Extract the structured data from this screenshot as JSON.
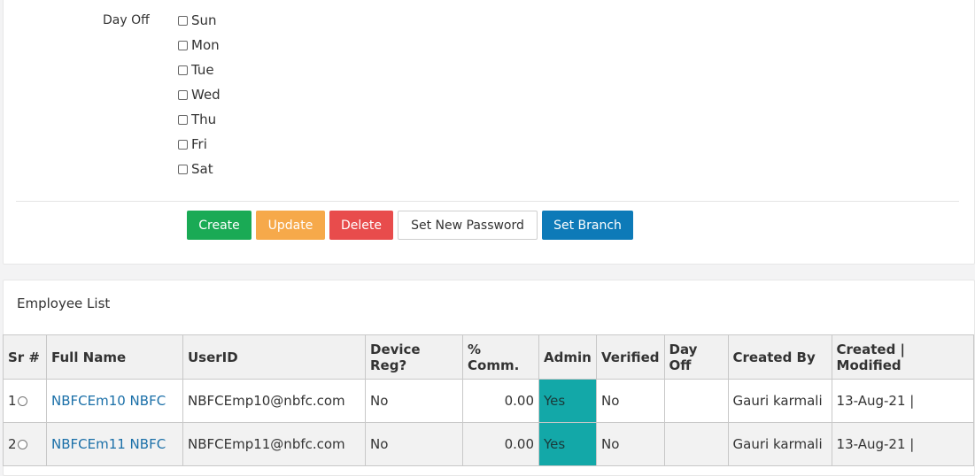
{
  "form": {
    "day_off_label": "Day Off",
    "days": [
      "Sun",
      "Mon",
      "Tue",
      "Wed",
      "Thu",
      "Fri",
      "Sat"
    ]
  },
  "buttons": {
    "create": "Create",
    "update": "Update",
    "delete": "Delete",
    "set_password": "Set New Password",
    "set_branch": "Set Branch"
  },
  "list": {
    "title": "Employee List",
    "headers": {
      "sr": "Sr #",
      "full_name": "Full Name",
      "userid": "UserID",
      "device_reg": "Device Reg?",
      "comm": "% Comm.",
      "admin": "Admin",
      "verified": "Verified",
      "day_off": "Day Off",
      "created_by": "Created By",
      "created_modified": "Created | Modified"
    },
    "rows": [
      {
        "sr": "1",
        "full_name": "NBFCEm10 NBFC",
        "userid": "NBFCEmp10@nbfc.com",
        "device_reg": "No",
        "comm": "0.00",
        "admin": "Yes",
        "verified": "No",
        "day_off": "",
        "created_by": "Gauri karmali",
        "created_modified": "13-Aug-21 |"
      },
      {
        "sr": "2",
        "full_name": "NBFCEm11 NBFC",
        "userid": "NBFCEmp11@nbfc.com",
        "device_reg": "No",
        "comm": "0.00",
        "admin": "Yes",
        "verified": "No",
        "day_off": "",
        "created_by": "Gauri karmali",
        "created_modified": "13-Aug-21 |"
      }
    ]
  },
  "colors": {
    "create": "#1aaa55",
    "update": "#f6a94a",
    "delete": "#e84c4c",
    "set_branch": "#0d7ab8",
    "admin_yes": "#13a8a8",
    "link": "#1a6fa8"
  }
}
